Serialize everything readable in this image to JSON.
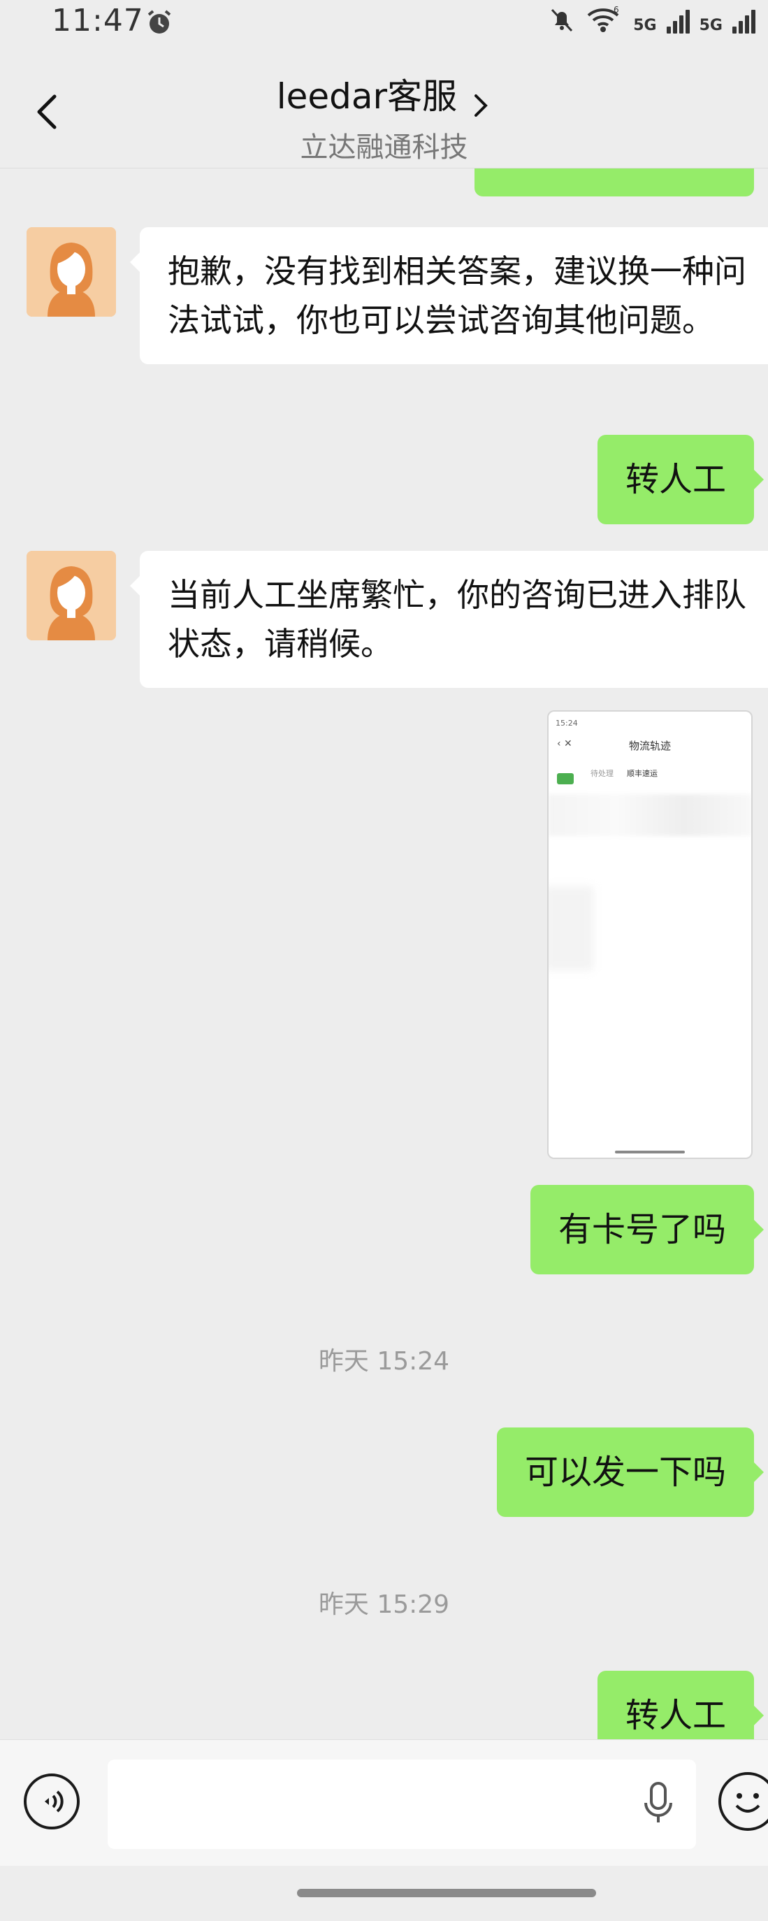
{
  "status_bar": {
    "time": "11:47",
    "network_1": "5G",
    "network_2": "5G",
    "icons": [
      "alarm-icon",
      "mute-icon",
      "wifi-icon",
      "signal-icon",
      "signal-icon"
    ]
  },
  "header": {
    "title": "leedar客服",
    "subtitle": "立达融通科技",
    "icons": [
      "back-arrow-icon",
      "chevron-right-icon"
    ]
  },
  "messages": [
    {
      "type": "incoming",
      "text": "抱歉，没有找到相关答案，建议换一种问法试试，你也可以尝试咨询其他问题。"
    },
    {
      "type": "outgoing",
      "text": "转人工"
    },
    {
      "type": "incoming",
      "text": "当前人工坐席繁忙，你的咨询已进入排队状态，请稍候。"
    },
    {
      "type": "outgoing_image",
      "screenshot": {
        "time": "15:24",
        "title": "物流轨迹",
        "line_left": "待处理",
        "line_right": "顺丰速运"
      }
    },
    {
      "type": "outgoing",
      "text": "有卡号了吗"
    },
    {
      "type": "timestamp",
      "text": "昨天 15:24"
    },
    {
      "type": "outgoing",
      "text": "可以发一下吗"
    },
    {
      "type": "timestamp",
      "text": "昨天 15:29"
    },
    {
      "type": "outgoing",
      "text": "转人工"
    }
  ],
  "input_bar": {
    "placeholder": "",
    "icons": [
      "voice-icon",
      "mic-icon",
      "emoji-icon"
    ]
  },
  "colors": {
    "background": "#ededed",
    "outgoing_bubble": "#95ec69",
    "incoming_bubble": "#ffffff",
    "avatar_bg": "#f4c79a"
  }
}
